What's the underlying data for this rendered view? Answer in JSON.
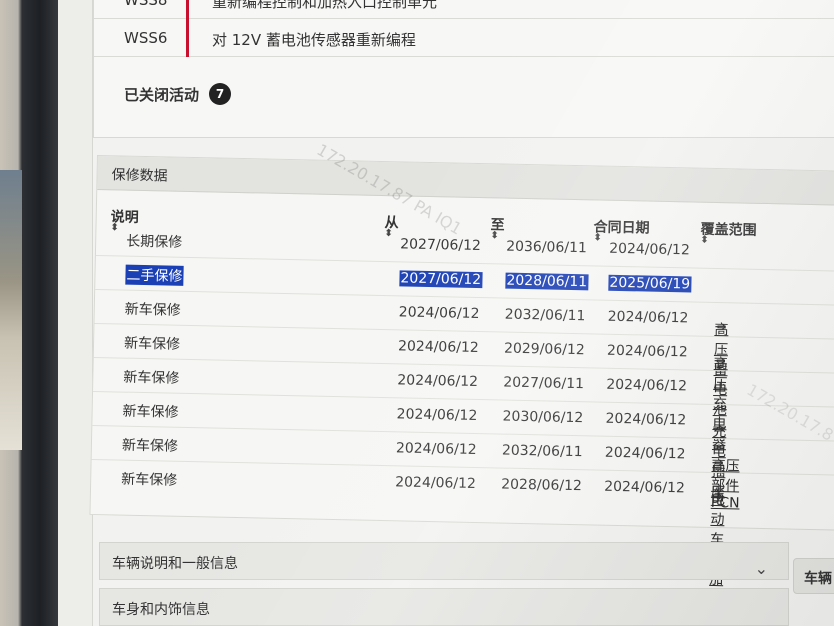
{
  "campaigns": {
    "rows": [
      {
        "code": "WSS8",
        "description": "重新编程控制和加热入口控制单元"
      },
      {
        "code": "WSS6",
        "description": "对 12V 蓄电池传感器重新编程"
      }
    ],
    "closed_label": "已关闭活动",
    "closed_count": "7"
  },
  "warranty": {
    "title": "保修数据",
    "columns": [
      "说明",
      "从",
      "至",
      "合同日期",
      "覆盖范围"
    ],
    "rows": [
      {
        "description": "长期保修",
        "from": "2027/06/12",
        "to": "2036/06/11",
        "contract_date": "2024/06/12",
        "coverage": ""
      },
      {
        "description": "二手保修",
        "from": "2027/06/12",
        "to": "2028/06/11",
        "contract_date": "2025/06/19",
        "coverage": "",
        "selected": true
      },
      {
        "description": "新车保修",
        "from": "2024/06/12",
        "to": "2032/06/11",
        "contract_date": "2024/06/12",
        "coverage": "高压蓄电池"
      },
      {
        "description": "新车保修",
        "from": "2024/06/12",
        "to": "2029/06/12",
        "contract_date": "2024/06/12",
        "coverage": "高压充电器"
      },
      {
        "description": "新车保修",
        "from": "2024/06/12",
        "to": "2027/06/11",
        "contract_date": "2024/06/12",
        "coverage": ""
      },
      {
        "description": "新车保修",
        "from": "2024/06/12",
        "to": "2030/06/12",
        "contract_date": "2024/06/12",
        "coverage": "充电插座"
      },
      {
        "description": "新车保修",
        "from": "2024/06/12",
        "to": "2032/06/11",
        "contract_date": "2024/06/12",
        "coverage": "高压部件 PCN"
      },
      {
        "description": "新车保修",
        "from": "2024/06/12",
        "to": "2028/06/12",
        "contract_date": "2024/06/12",
        "coverage": "电动车内加热器"
      }
    ],
    "arrow_glyph": "→"
  },
  "sections": {
    "vehicle_info": "车辆说明和一般信息",
    "body_interior": "车身和内饰信息",
    "side_button": "车辆"
  },
  "watermark": "172.20.17.87 PA IQ1",
  "watermark2": "172.20.17.8",
  "colors": {
    "accent_red": "#c8102e",
    "selection_blue": "#1b3fb4",
    "badge_bg": "#222222"
  },
  "icons": {
    "sort": "sort-icon",
    "chevron": "chevron-down-icon",
    "arrow": "arrow-right-icon"
  }
}
